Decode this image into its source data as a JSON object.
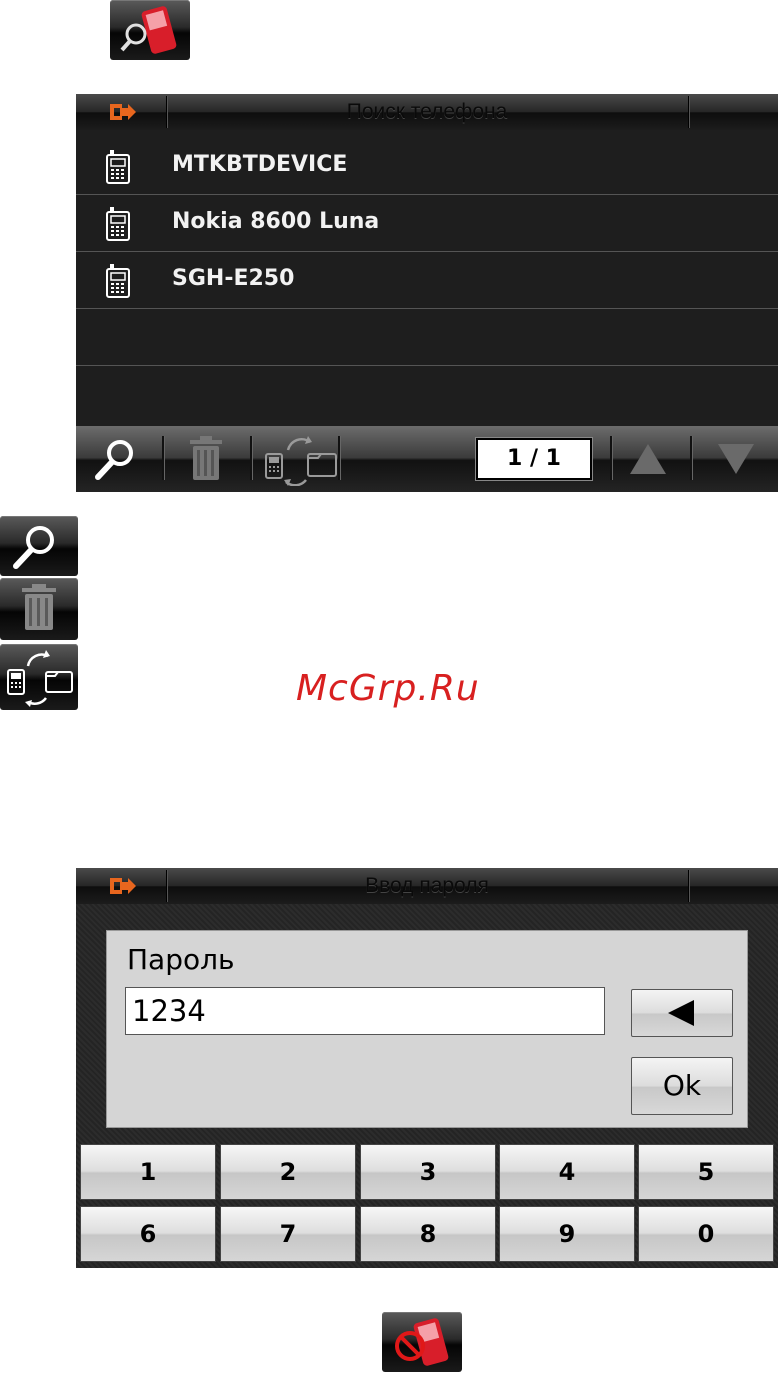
{
  "top_icon": {
    "name": "bluetooth-phone-search-icon"
  },
  "screen1": {
    "title": "Поиск телефона",
    "devices": [
      {
        "name": "MTKBTDEVICE"
      },
      {
        "name": "Nokia 8600 Luna"
      },
      {
        "name": "SGH-E250"
      }
    ],
    "pager": "1 / 1"
  },
  "legend_icons": [
    "search-icon",
    "trash-icon",
    "phone-sync-icon"
  ],
  "watermark": "McGrp.Ru",
  "screen2": {
    "title": "Ввод пароля",
    "password_label": "Пароль",
    "password_value": "1234",
    "ok_label": "Ok",
    "keys_row1": [
      "1",
      "2",
      "3",
      "4",
      "5"
    ],
    "keys_row2": [
      "6",
      "7",
      "8",
      "9",
      "0"
    ]
  },
  "bottom_icon": {
    "name": "phone-disconnect-icon"
  },
  "colors": {
    "accent_orange": "#e8661e",
    "watermark_red": "#d82020"
  }
}
